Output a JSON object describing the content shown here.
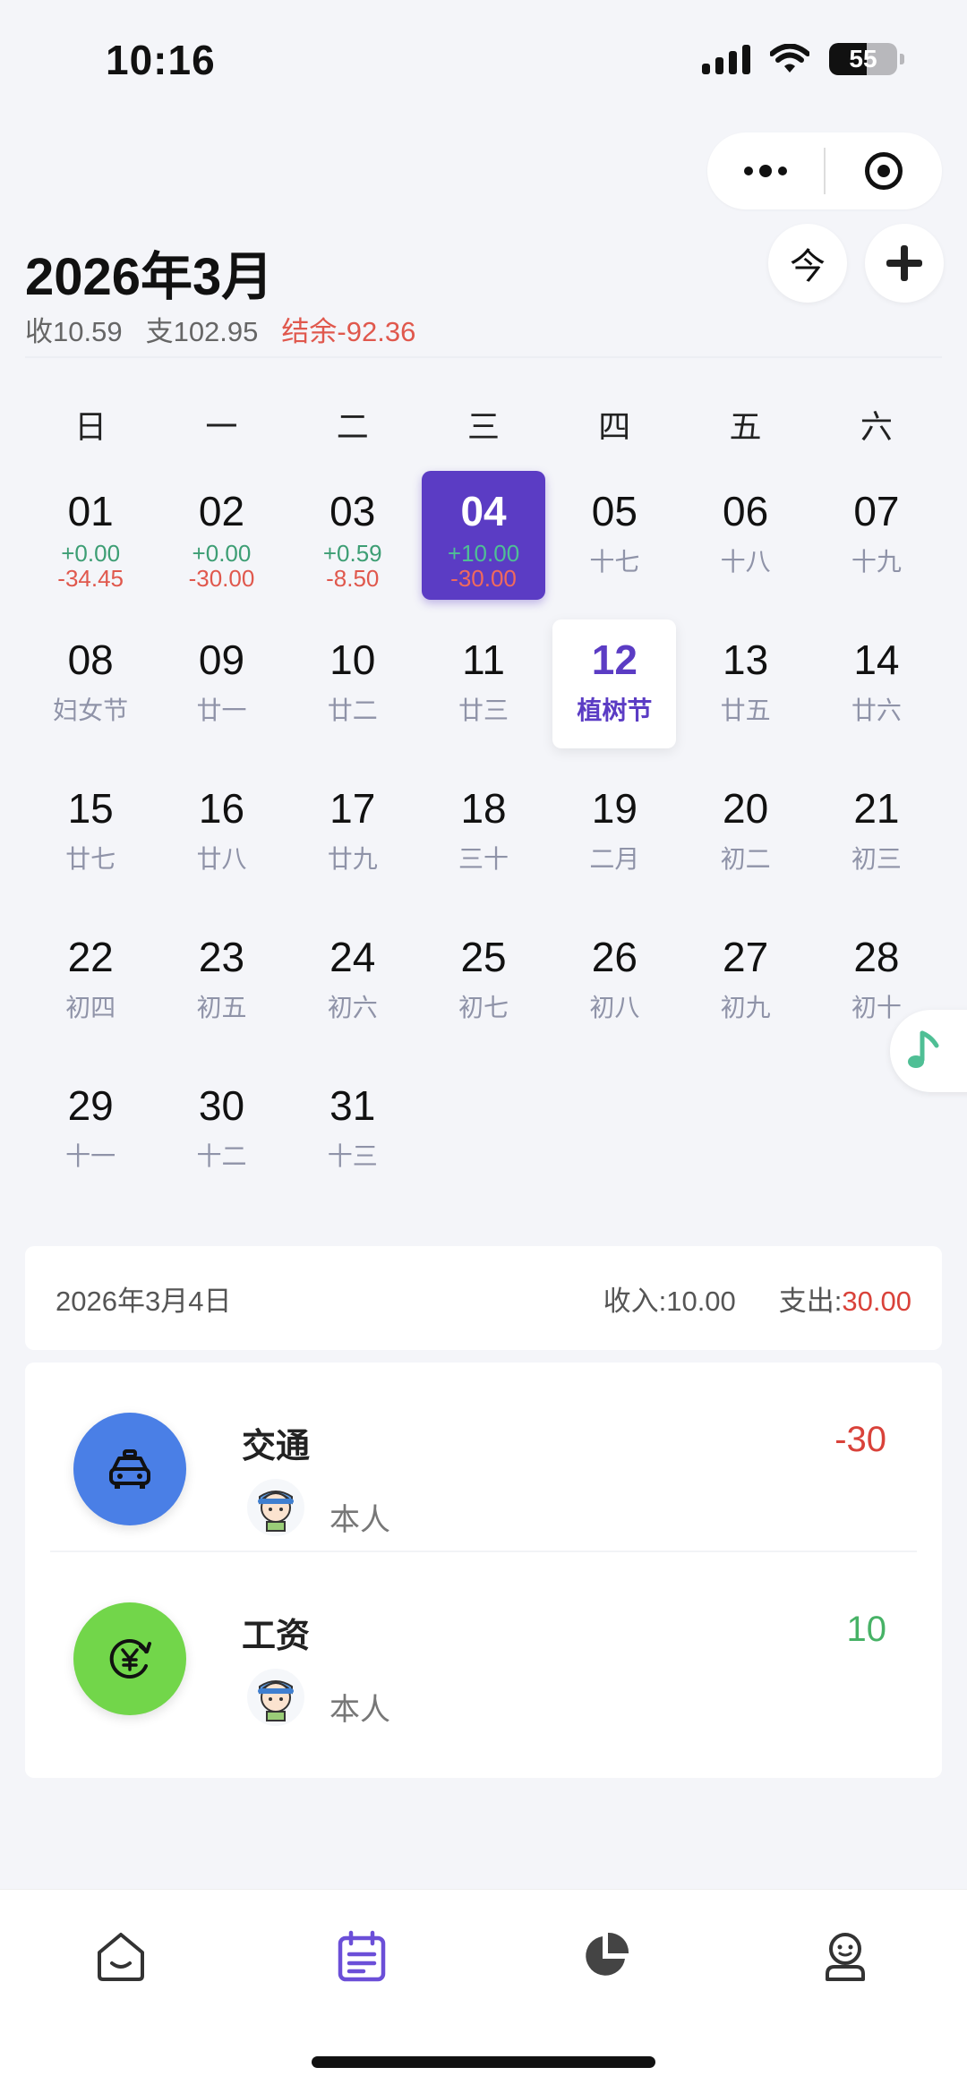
{
  "status_bar": {
    "time": "10:16",
    "battery": "55",
    "battery_level": 0.55
  },
  "header": {
    "title": "2026年3月",
    "income": "收10.59",
    "expense": "支102.95",
    "balance": "结余-92.36",
    "today_button": "今",
    "add_button_icon": "plus-icon"
  },
  "calendar": {
    "weekdays": [
      "日",
      "一",
      "二",
      "三",
      "四",
      "五",
      "六"
    ],
    "days": [
      {
        "date": "01",
        "inc": "+0.00",
        "exp": "-34.45"
      },
      {
        "date": "02",
        "inc": "+0.00",
        "exp": "-30.00"
      },
      {
        "date": "03",
        "inc": "+0.59",
        "exp": "-8.50"
      },
      {
        "date": "04",
        "inc": "+10.00",
        "exp": "-30.00",
        "state": "selected"
      },
      {
        "date": "05",
        "sub": "十七"
      },
      {
        "date": "06",
        "sub": "十八"
      },
      {
        "date": "07",
        "sub": "十九"
      },
      {
        "date": "08",
        "sub": "妇女节"
      },
      {
        "date": "09",
        "sub": "廿一"
      },
      {
        "date": "10",
        "sub": "廿二"
      },
      {
        "date": "11",
        "sub": "廿三"
      },
      {
        "date": "12",
        "sub": "植树节",
        "state": "today"
      },
      {
        "date": "13",
        "sub": "廿五"
      },
      {
        "date": "14",
        "sub": "廿六"
      },
      {
        "date": "15",
        "sub": "廿七"
      },
      {
        "date": "16",
        "sub": "廿八"
      },
      {
        "date": "17",
        "sub": "廿九"
      },
      {
        "date": "18",
        "sub": "三十"
      },
      {
        "date": "19",
        "sub": "二月"
      },
      {
        "date": "20",
        "sub": "初二"
      },
      {
        "date": "21",
        "sub": "初三"
      },
      {
        "date": "22",
        "sub": "初四"
      },
      {
        "date": "23",
        "sub": "初五"
      },
      {
        "date": "24",
        "sub": "初六"
      },
      {
        "date": "25",
        "sub": "初七"
      },
      {
        "date": "26",
        "sub": "初八"
      },
      {
        "date": "27",
        "sub": "初九"
      },
      {
        "date": "28",
        "sub": "初十"
      },
      {
        "date": "29",
        "sub": "十一"
      },
      {
        "date": "30",
        "sub": "十二"
      },
      {
        "date": "31",
        "sub": "十三"
      }
    ]
  },
  "day_summary": {
    "date": "2026年3月4日",
    "income": "收入:10.00",
    "expense_label": "支出:",
    "expense_value": "30.00"
  },
  "records": [
    {
      "category": "交通",
      "icon": "taxi-icon",
      "color": "#4a7fe6",
      "owner": "本人",
      "amount": "-30",
      "amount_color": "#d9423a"
    },
    {
      "category": "工资",
      "icon": "salary-icon",
      "color": "#72d64a",
      "owner": "本人",
      "amount": "10",
      "amount_color": "#47b266"
    }
  ],
  "tabbar": {
    "tabs": [
      {
        "icon": "home-icon",
        "active": false
      },
      {
        "icon": "calendar-icon",
        "active": true
      },
      {
        "icon": "pie-chart-icon",
        "active": false
      },
      {
        "icon": "profile-icon",
        "active": false
      }
    ]
  },
  "colors": {
    "accent": "#5b3cc4",
    "income": "#3d9e74",
    "expense": "#e0584d"
  }
}
